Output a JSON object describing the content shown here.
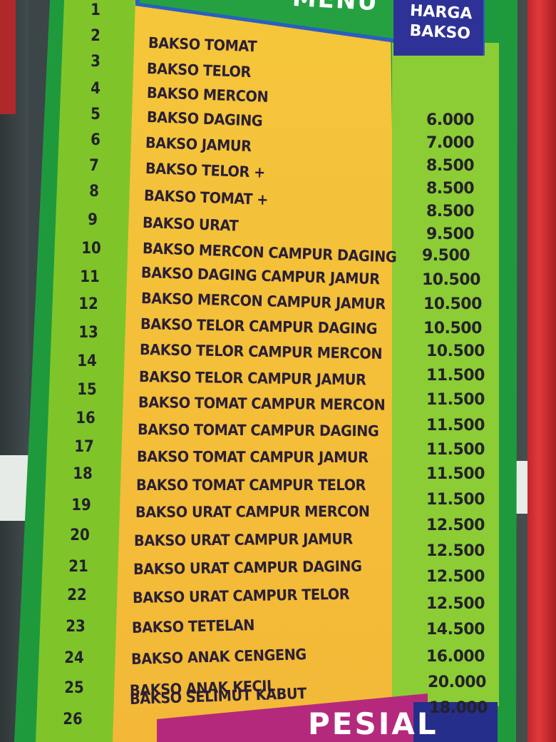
{
  "header": {
    "title_partial": "MENU",
    "price_header": "HARGA BAKSO"
  },
  "footer": {
    "partial_text": "PESIAL"
  },
  "menu": [
    {
      "no": "1",
      "name": "",
      "price": ""
    },
    {
      "no": "2",
      "name": "BAKSO TOMAT",
      "price": ""
    },
    {
      "no": "3",
      "name": "BAKSO TELOR",
      "price": "6.000"
    },
    {
      "no": "4",
      "name": "BAKSO MERCON",
      "price": "7.000"
    },
    {
      "no": "5",
      "name": "BAKSO DAGING",
      "price": "8.500"
    },
    {
      "no": "6",
      "name": "BAKSO JAMUR",
      "price": "8.500"
    },
    {
      "no": "7",
      "name": "BAKSO TELOR +",
      "price": "8.500"
    },
    {
      "no": "8",
      "name": "BAKSO TOMAT +",
      "price": "9.500"
    },
    {
      "no": "9",
      "name": "BAKSO URAT",
      "price": "9.500"
    },
    {
      "no": "10",
      "name": "BAKSO MERCON CAMPUR DAGING",
      "price": "10.500"
    },
    {
      "no": "11",
      "name": "BAKSO DAGING CAMPUR JAMUR",
      "price": "10.500"
    },
    {
      "no": "12",
      "name": "BAKSO MERCON CAMPUR JAMUR",
      "price": "10.500"
    },
    {
      "no": "13",
      "name": "BAKSO TELOR CAMPUR DAGING",
      "price": "10.500"
    },
    {
      "no": "14",
      "name": "BAKSO TELOR CAMPUR MERCON",
      "price": "11.500"
    },
    {
      "no": "15",
      "name": "BAKSO TELOR CAMPUR JAMUR",
      "price": "11.500"
    },
    {
      "no": "16",
      "name": "BAKSO TOMAT CAMPUR MERCON",
      "price": "11.500"
    },
    {
      "no": "17",
      "name": "BAKSO TOMAT CAMPUR DAGING",
      "price": "11.500"
    },
    {
      "no": "18",
      "name": "BAKSO TOMAT CAMPUR JAMUR",
      "price": "11.500"
    },
    {
      "no": "19",
      "name": "BAKSO TOMAT CAMPUR TELOR",
      "price": "11.500"
    },
    {
      "no": "20",
      "name": "BAKSO URAT CAMPUR MERCON",
      "price": "12.500"
    },
    {
      "no": "21",
      "name": "BAKSO URAT CAMPUR JAMUR",
      "price": "12.500"
    },
    {
      "no": "22",
      "name": "BAKSO URAT CAMPUR DAGING",
      "price": "12.500"
    },
    {
      "no": "23",
      "name": "BAKSO URAT CAMPUR TELOR",
      "price": "12.500"
    },
    {
      "no": "24",
      "name": "BAKSO TETELAN",
      "price": "14.500"
    },
    {
      "no": "25",
      "name": "BAKSO ANAK CENGENG",
      "price": "16.000"
    },
    {
      "no": "26",
      "name": "BAKSO ANAK KECIL",
      "price": "20.000"
    },
    {
      "no": "",
      "name": "BAKSO SELIMUT KABUT",
      "price": "18.000"
    },
    {
      "no": "",
      "name": "",
      "price": "12.500"
    }
  ],
  "colors": {
    "banner_green": "#1e9a3d",
    "panel_yellow": "#f5c63a",
    "light_green": "#8ccc35",
    "header_navy": "#2e3296",
    "header_blue": "#2a5fc0",
    "footer_magenta": "#b5297d",
    "frame_red": "#c2272b",
    "text_dark": "#2a1f35"
  }
}
